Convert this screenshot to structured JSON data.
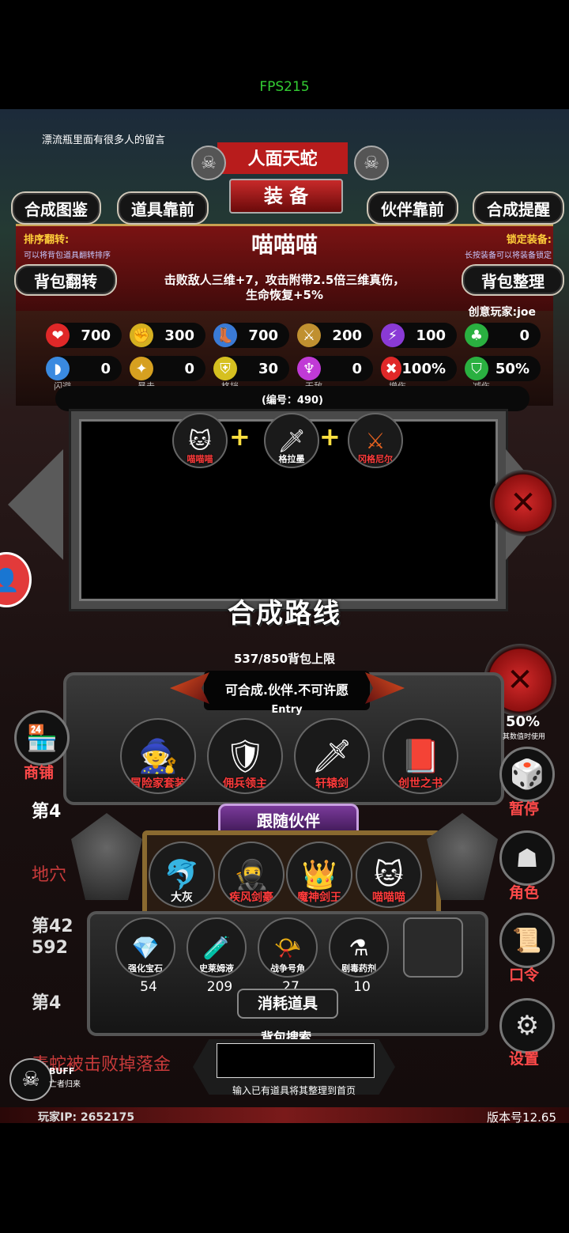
{
  "fps": "FPS215",
  "drift_text": "漂流瓶里面有很多人的留言",
  "boss_name": "人面天蛇",
  "equip_title": "装 备",
  "top_tabs": [
    "合成图鉴",
    "道具靠前",
    "伙伴靠前",
    "合成提醒"
  ],
  "sort_flip": {
    "title": "排序翻转:",
    "desc": "可以将背包道具翻转排序"
  },
  "lock_equip": {
    "title": "锁定装备:",
    "desc": "长按装备可以将装备锁定"
  },
  "item": {
    "name": "喵喵喵",
    "desc_line1": "击败敌人三维+7，攻击附带2.5倍三维真伤，",
    "desc_line2": "生命恢复+5%",
    "creator": "创意玩家:joe",
    "code": "(编号：490)"
  },
  "bag_flip_btn": "背包翻转",
  "bag_sort_btn": "背包整理",
  "stats_row1": [
    {
      "icon": "heart-icon",
      "value": "700",
      "color": "#e02828"
    },
    {
      "icon": "strength-icon",
      "value": "300",
      "color": "#d6b020"
    },
    {
      "icon": "boot-icon",
      "value": "700",
      "color": "#3a7ad6"
    },
    {
      "icon": "sword-icon",
      "value": "200",
      "color": "#c09030"
    },
    {
      "icon": "lightning-icon",
      "value": "100",
      "color": "#8a3ad6"
    },
    {
      "icon": "clover-icon",
      "value": "0",
      "color": "#2ab040"
    }
  ],
  "stats_row2": [
    {
      "icon": "dodge-icon",
      "value": "0",
      "label": "闪避",
      "color": "#3a8ae0"
    },
    {
      "icon": "crit-icon",
      "value": "0",
      "label": "暴击",
      "color": "#d6a020"
    },
    {
      "icon": "block-icon",
      "value": "30",
      "label": "格挡",
      "color": "#d6c020"
    },
    {
      "icon": "invincible-icon",
      "value": "0",
      "label": "无敌",
      "color": "#c03ad6"
    },
    {
      "icon": "damage-up-icon",
      "value": "100%",
      "label": "增伤",
      "color": "#e02828"
    },
    {
      "icon": "damage-down-icon",
      "value": "50%",
      "label": "减伤",
      "color": "#2ab040"
    }
  ],
  "recipe": [
    {
      "label": "喵喵喵",
      "color": "#ff3b3b"
    },
    {
      "label": "格拉墨",
      "color": "#ffffff"
    },
    {
      "label": "冈格尼尔",
      "color": "#ff3b3b"
    }
  ],
  "plus": "+",
  "synth_route": "合成路线",
  "bag_limit": "537/850背包上限",
  "synth_hint": "可合成.伙伴.不可许愿",
  "entry": "Entry",
  "partners_equip": [
    {
      "label": "冒险家套装",
      "color": "#ff3b3b"
    },
    {
      "label": "佣兵领主",
      "color": "#ff3b3b"
    },
    {
      "label": "轩辕剑",
      "color": "#ff3b3b"
    },
    {
      "label": "创世之书",
      "color": "#ff3b3b"
    }
  ],
  "follow_title": "跟随伙伴",
  "followers": [
    {
      "label": "大灰",
      "color": "#ffffff"
    },
    {
      "label": "疾风剑豪",
      "color": "#ff3b3b"
    },
    {
      "label": "魔神剑王",
      "color": "#ff3b3b"
    },
    {
      "label": "喵喵喵",
      "color": "#ff3b3b"
    }
  ],
  "consumables": [
    {
      "label": "强化宝石",
      "count": "54"
    },
    {
      "label": "史莱姆液",
      "count": "209"
    },
    {
      "label": "战争号角",
      "count": "27"
    },
    {
      "label": "剧毒药剂",
      "count": "10"
    }
  ],
  "consumable_title": "消耗道具",
  "bag_search_title": "背包搜索",
  "bag_search_hint": "输入已有道具将其整理到首页",
  "side": {
    "shop": "商铺",
    "pause": "暂停",
    "role": "角色",
    "code": "口令",
    "settings": "设置",
    "value_note": "其数值时使用",
    "value_pct": "50%"
  },
  "bg_texts": {
    "di4": "第4",
    "cave": "地穴",
    "di42": "第42",
    "n592": "592",
    "di4b": "第4",
    "snake": "毒蛇被击败掉落金"
  },
  "buff": {
    "title": "BUFF",
    "desc": "亡者归来"
  },
  "player_ip": "玩家IP:  2652175",
  "version": "版本号12.65"
}
